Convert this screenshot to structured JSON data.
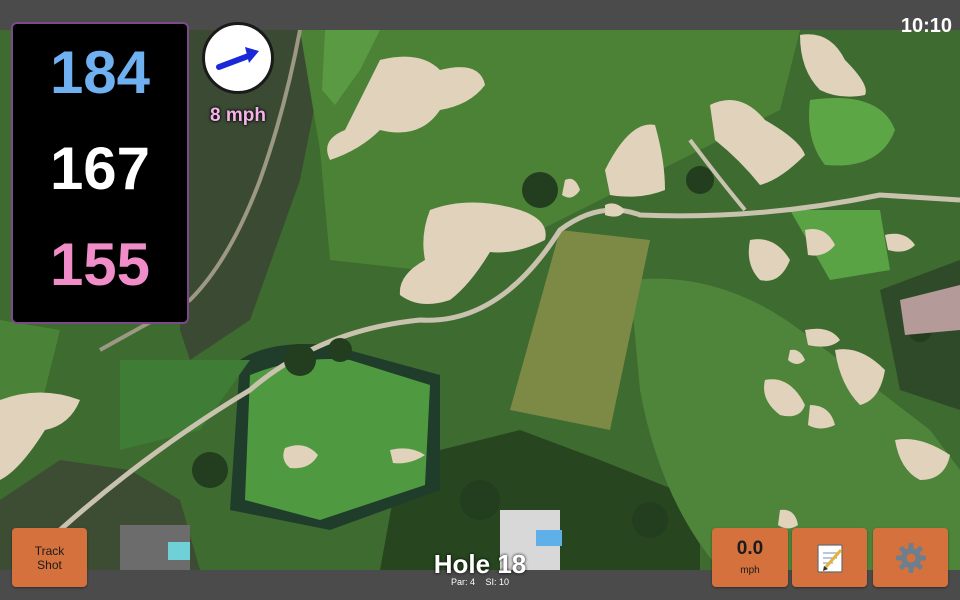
{
  "status": {
    "time": "10:10"
  },
  "distances": {
    "back": {
      "value": "184",
      "color": "#6fb0f0"
    },
    "center": {
      "value": "167",
      "color": "#ffffff"
    },
    "front": {
      "value": "155",
      "color": "#f08cc8"
    }
  },
  "wind": {
    "speed_label": "8 mph",
    "label_color": "#f5b3ea",
    "arrow_color": "#1a28d8",
    "direction": "toward upper-right",
    "icon": "wind-arrow-icon"
  },
  "buttons": {
    "track_shot": {
      "line1": "Track",
      "line2": "Shot"
    },
    "speed": {
      "value": "0.0",
      "unit": "mph"
    },
    "notes": {
      "icon": "notepad-icon"
    },
    "settings": {
      "icon": "gear-icon"
    }
  },
  "hole": {
    "title": "Hole 18",
    "par": "Par: 4",
    "si": "SI: 10"
  },
  "map": {
    "type": "satellite course map"
  },
  "colors": {
    "button": "#d4713d",
    "bar": "#4b4b4b",
    "panel_border": "#7b4a8a"
  }
}
